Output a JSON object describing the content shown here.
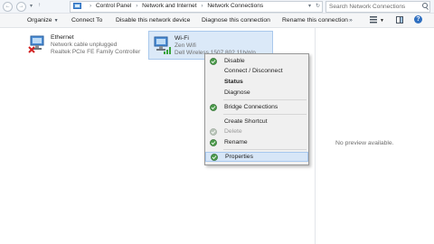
{
  "address": {
    "crumbs": [
      "Control Panel",
      "Network and Internet",
      "Network Connections"
    ],
    "search_placeholder": "Search Network Connections"
  },
  "toolbar": {
    "organize": "Organize",
    "connect_to": "Connect To",
    "disable": "Disable this network device",
    "diagnose": "Diagnose this connection",
    "rename": "Rename this connection"
  },
  "connections": [
    {
      "name": "Ethernet",
      "status": "Network cable unplugged",
      "adapter": "Realtek PCIe FE Family Controller"
    },
    {
      "name": "Wi-Fi",
      "status": "Zen Wifi",
      "adapter": "Dell Wireless 1507 802.11b/g/n"
    }
  ],
  "context_menu": {
    "items": [
      {
        "label": "Disable",
        "shield": true
      },
      {
        "label": "Connect / Disconnect",
        "shield": false
      },
      {
        "label": "Status",
        "shield": false,
        "bold": true
      },
      {
        "label": "Diagnose",
        "shield": false
      },
      {
        "label": "Bridge Connections",
        "shield": true
      },
      {
        "label": "Create Shortcut",
        "shield": false
      },
      {
        "label": "Delete",
        "shield": true,
        "disabled": true
      },
      {
        "label": "Rename",
        "shield": true
      },
      {
        "label": "Properties",
        "shield": true,
        "highlighted": true
      }
    ]
  },
  "preview_pane": {
    "message": "No preview available."
  },
  "colors": {
    "selection": "#dbe9f8",
    "menu_highlight": "#d7e6f7",
    "accent": "#2f6fc0"
  },
  "icons": [
    "back-arrow-icon",
    "forward-arrow-icon",
    "up-arrow-icon",
    "search-icon",
    "help-icon",
    "uac-shield-icon",
    "network-adapter-icon",
    "wifi-signal-icon"
  ]
}
